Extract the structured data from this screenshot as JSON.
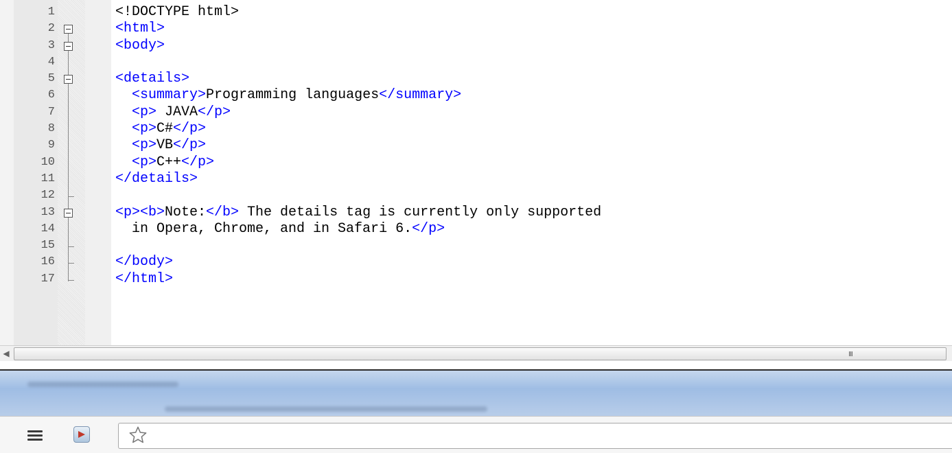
{
  "editor": {
    "lines": [
      {
        "n": "1",
        "segments": [
          {
            "t": "<!DOCTYPE html>",
            "k": "text"
          }
        ]
      },
      {
        "n": "2",
        "segments": [
          {
            "t": "<html>",
            "k": "tag"
          }
        ]
      },
      {
        "n": "3",
        "segments": [
          {
            "t": "<body>",
            "k": "tag"
          }
        ]
      },
      {
        "n": "4",
        "segments": []
      },
      {
        "n": "5",
        "segments": [
          {
            "t": "<details>",
            "k": "tag"
          }
        ]
      },
      {
        "n": "6",
        "segments": [
          {
            "t": "  ",
            "k": "text"
          },
          {
            "t": "<summary>",
            "k": "tag"
          },
          {
            "t": "Programming languages",
            "k": "text"
          },
          {
            "t": "</summary>",
            "k": "tag"
          }
        ]
      },
      {
        "n": "7",
        "segments": [
          {
            "t": "  ",
            "k": "text"
          },
          {
            "t": "<p>",
            "k": "tag"
          },
          {
            "t": " JAVA",
            "k": "text"
          },
          {
            "t": "</p>",
            "k": "tag"
          }
        ]
      },
      {
        "n": "8",
        "segments": [
          {
            "t": "  ",
            "k": "text"
          },
          {
            "t": "<p>",
            "k": "tag"
          },
          {
            "t": "C#",
            "k": "text"
          },
          {
            "t": "</p>",
            "k": "tag"
          }
        ]
      },
      {
        "n": "9",
        "segments": [
          {
            "t": "  ",
            "k": "text"
          },
          {
            "t": "<p>",
            "k": "tag"
          },
          {
            "t": "VB",
            "k": "text"
          },
          {
            "t": "</p>",
            "k": "tag"
          }
        ]
      },
      {
        "n": "10",
        "segments": [
          {
            "t": "  ",
            "k": "text"
          },
          {
            "t": "<p>",
            "k": "tag"
          },
          {
            "t": "C++",
            "k": "text"
          },
          {
            "t": "</p>",
            "k": "tag"
          }
        ]
      },
      {
        "n": "11",
        "segments": [
          {
            "t": "</details>",
            "k": "tag"
          }
        ]
      },
      {
        "n": "12",
        "segments": []
      },
      {
        "n": "13",
        "segments": [
          {
            "t": "<p><b>",
            "k": "tag"
          },
          {
            "t": "Note:",
            "k": "text"
          },
          {
            "t": "</b>",
            "k": "tag"
          },
          {
            "t": " The details tag is currently only supported",
            "k": "text"
          }
        ]
      },
      {
        "n": "14",
        "segments": [
          {
            "t": "  in Opera, Chrome, and in Safari 6.",
            "k": "text"
          },
          {
            "t": "</p>",
            "k": "tag"
          }
        ]
      },
      {
        "n": "15",
        "segments": []
      },
      {
        "n": "16",
        "segments": [
          {
            "t": "</body>",
            "k": "tag"
          }
        ]
      },
      {
        "n": "17",
        "segments": [
          {
            "t": "</html>",
            "k": "tag"
          }
        ]
      }
    ],
    "colors": {
      "tag": "#0000ff",
      "text": "#000000"
    }
  },
  "scrollbar": {
    "grip": "III"
  },
  "browser": {
    "icons": [
      "menu-icon",
      "extension-icon",
      "star-icon"
    ]
  }
}
